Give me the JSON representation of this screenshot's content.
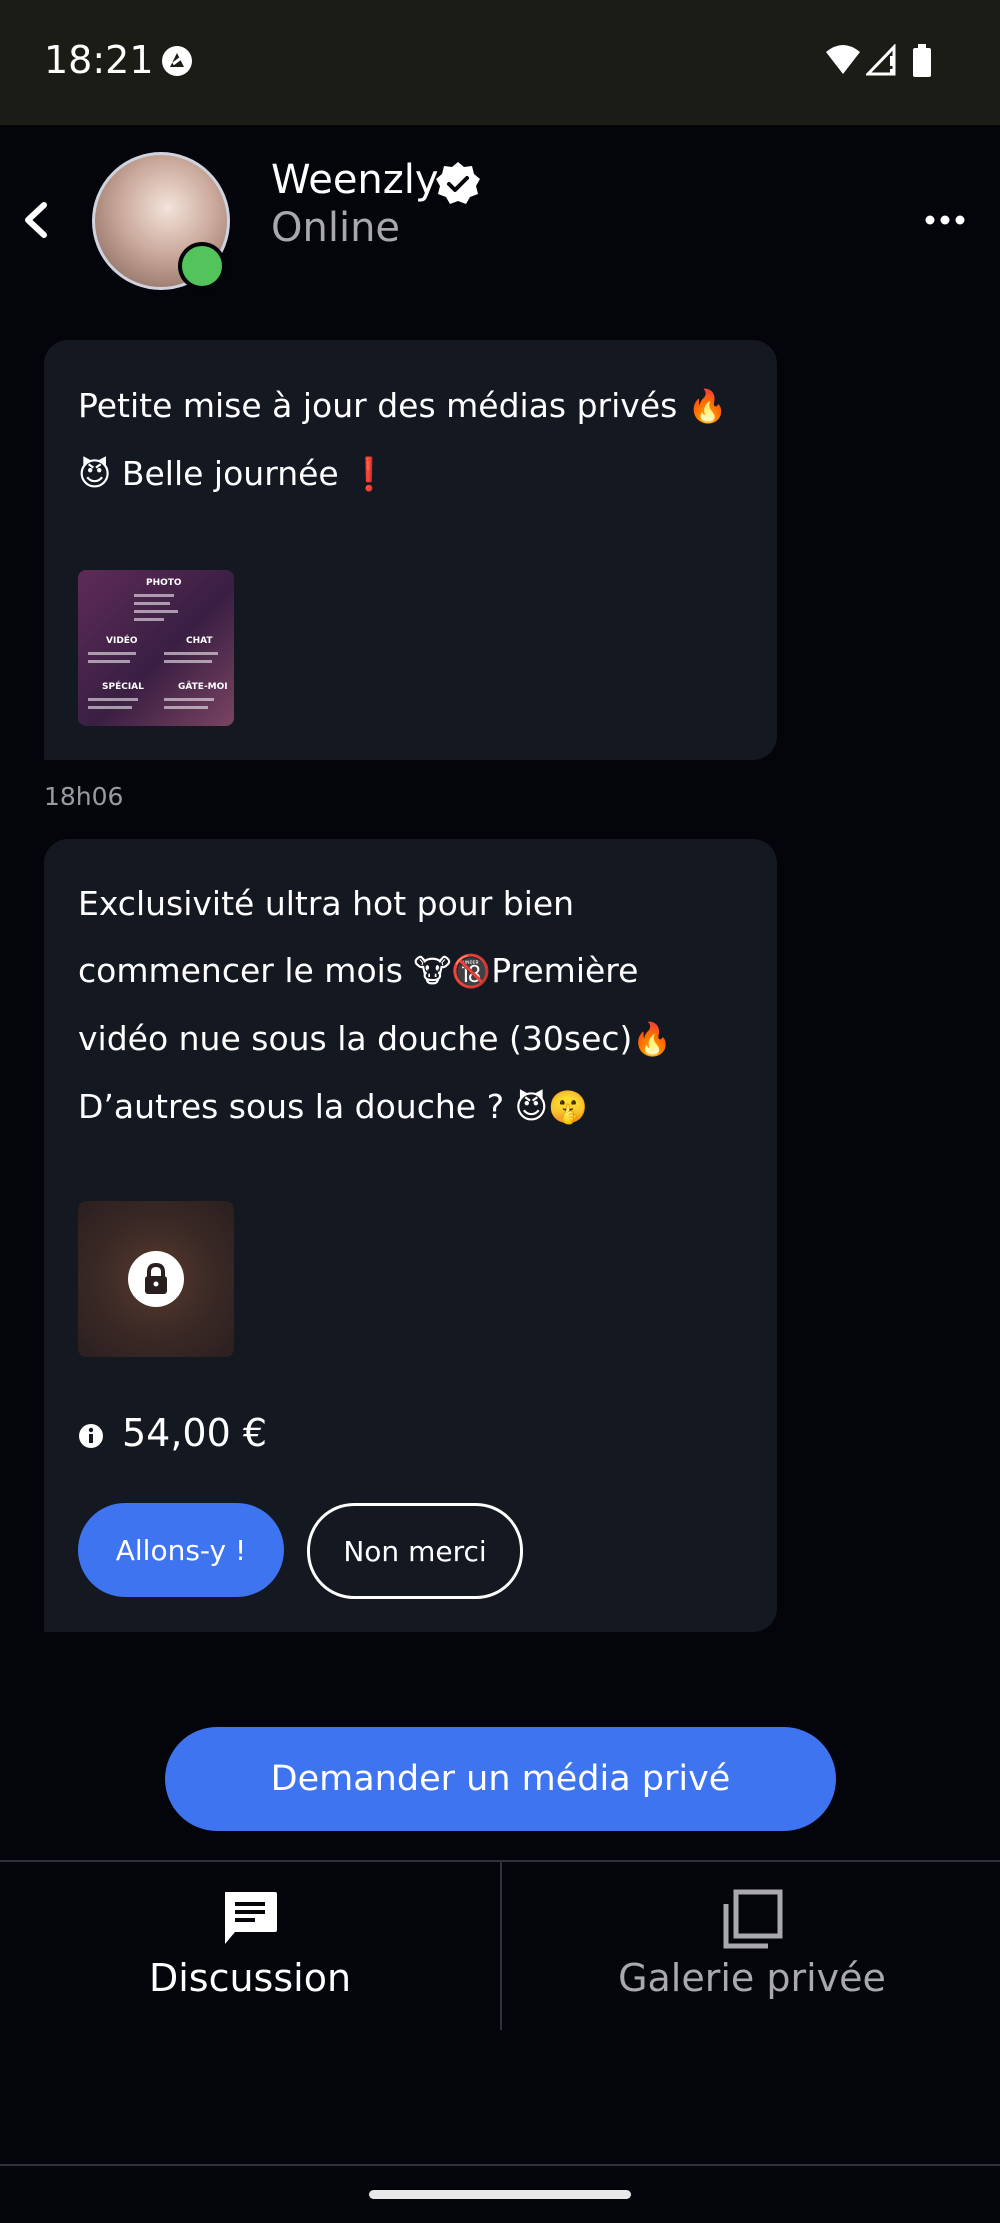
{
  "status_bar": {
    "time": "18:21"
  },
  "header": {
    "contact_name": "Weenzly",
    "contact_status": "Online",
    "icons": [
      "back-arrow-icon",
      "verified-badge-icon",
      "more-options-icon"
    ]
  },
  "messages": [
    {
      "line1": "Petite mise à jour des médias privés",
      "line1_emoji": "🔥",
      "line2_emoji_lead": "😈",
      "line2": "Belle journée",
      "line2_emoji_end": "❗",
      "time": "18h06"
    },
    {
      "line1": "Exclusivité ultra hot pour bien",
      "line2_a": "commencer le mois ",
      "line2_emojis": "🐮🔞",
      "line2_b": "Première",
      "line3": "vidéo nue sous la douche (30sec)",
      "line3_emoji": "🔥",
      "line4": "D’autres sous la douche ? ",
      "line4_emojis": "😈🤫",
      "price": "54,00 €",
      "accept_label": "Allons-y !",
      "decline_label": "Non merci"
    }
  ],
  "request_button": "Demander un média privé",
  "tabs": [
    {
      "label": "Discussion",
      "active": true
    },
    {
      "label": "Galerie privée",
      "active": false
    }
  ],
  "colors": {
    "background": "#03050a",
    "bubble": "#131821",
    "accent": "#3f74f0",
    "online": "#53c45b",
    "muted_text": "#a9a9ad"
  }
}
